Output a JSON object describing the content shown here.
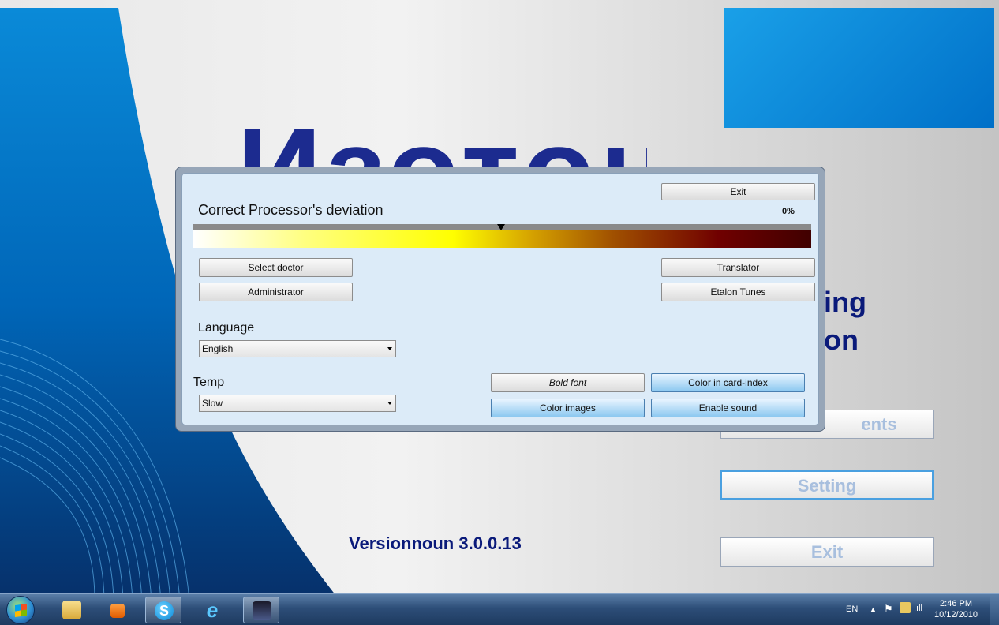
{
  "background": {
    "logo_text": "Изотон",
    "partial_texts": [
      "ing",
      "on",
      "ents"
    ],
    "version": "Versionnoun 3.0.0.13",
    "menu_buttons": {
      "setting": "Setting",
      "exit": "Exit"
    }
  },
  "dialog": {
    "title": "Correct Processor's deviation",
    "progress_percent": "0%",
    "progress_value": 0,
    "buttons": {
      "exit": "Exit",
      "select_doctor": "Select doctor",
      "administrator": "Administrator",
      "translator": "Translator",
      "etalon_tunes": "Etalon Tunes",
      "bold_font": "Bold font",
      "color_in_card_index": "Color in card-index",
      "color_images": "Color images",
      "enable_sound": "Enable sound"
    },
    "language": {
      "label": "Language",
      "selected": "English"
    },
    "temp": {
      "label": "Temp",
      "selected": "Slow"
    }
  },
  "taskbar": {
    "icons": [
      "start-orb",
      "explorer",
      "media-player",
      "skype",
      "internet-explorer",
      "app"
    ],
    "tray": {
      "language": "EN",
      "time": "2:46 PM",
      "date": "10/12/2010"
    }
  },
  "colors": {
    "accent": "#0a1a7a",
    "dialog_bg": "#dcebf8",
    "button_blue": "#8cc8f0"
  }
}
